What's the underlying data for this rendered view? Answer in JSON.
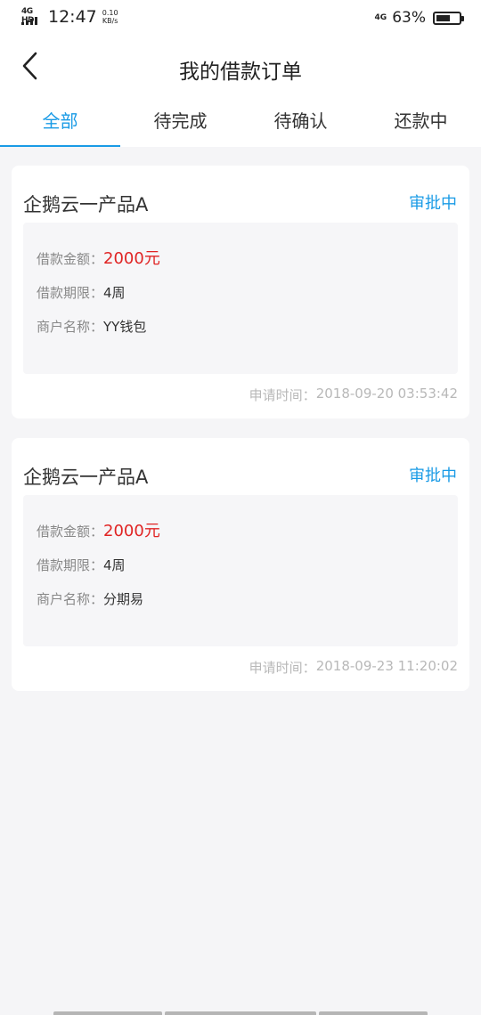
{
  "status_bar": {
    "network": "4G HD",
    "time": "12:47",
    "speed_value": "0.10",
    "speed_unit": "KB/s",
    "net_type": "4G",
    "battery": "63%",
    "battery_level": 0.63
  },
  "header": {
    "title": "我的借款订单",
    "back_icon": "chevron-left-icon"
  },
  "tabs": [
    {
      "label": "全部",
      "active": true
    },
    {
      "label": "待完成",
      "active": false
    },
    {
      "label": "待确认",
      "active": false
    },
    {
      "label": "还款中",
      "active": false
    }
  ],
  "orders": [
    {
      "title": "企鹅云一产品A",
      "status": "审批中",
      "amount_label": "借款金额：",
      "amount": "2000元",
      "term_label": "借款期限：",
      "term": "4周",
      "merchant_label": "商户名称：",
      "merchant": "YY钱包",
      "time_label": "申请时间：",
      "time": "2018-09-20 03:53:42"
    },
    {
      "title": "企鹅云一产品A",
      "status": "审批中",
      "amount_label": "借款金额：",
      "amount": "2000元",
      "term_label": "借款期限：",
      "term": "4周",
      "merchant_label": "商户名称：",
      "merchant": "分期易",
      "time_label": "申请时间：",
      "time": "2018-09-23 11:20:02"
    }
  ],
  "colors": {
    "accent": "#1a9be6",
    "amount": "#e02424",
    "background": "#f5f5f7"
  }
}
